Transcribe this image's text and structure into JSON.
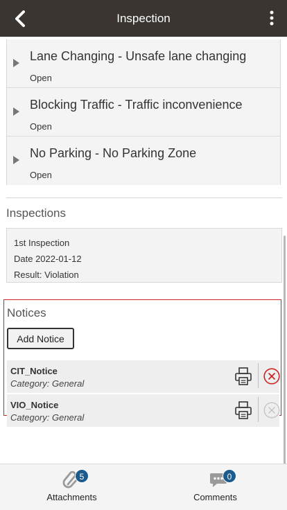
{
  "header": {
    "title": "Inspection",
    "back_icon": "chevron-left-icon",
    "menu_icon": "more-vertical-icon"
  },
  "violations": [
    {
      "title": "Lane Changing - Unsafe lane changing",
      "status": "Open"
    },
    {
      "title": "Blocking Traffic - Traffic inconvenience",
      "status": "Open"
    },
    {
      "title": "No Parking - No Parking Zone",
      "status": "Open"
    }
  ],
  "inspections": {
    "title": "Inspections",
    "card": {
      "name": "1st Inspection",
      "date": "Date 2022-01-12",
      "result": "Result: Violation"
    }
  },
  "notices": {
    "title": "Notices",
    "add_label": "Add Notice",
    "items": [
      {
        "name": "CIT_Notice",
        "category": "Category: General",
        "delete_enabled": true
      },
      {
        "name": "VIO_Notice",
        "category": "Category: General",
        "delete_enabled": false
      }
    ]
  },
  "bottom_tabs": [
    {
      "label": "Attachments",
      "badge": "5",
      "icon": "paperclip-icon"
    },
    {
      "label": "Comments",
      "badge": "0",
      "icon": "comment-icon"
    }
  ],
  "colors": {
    "header_bg": "#3a3530",
    "notices_border": "#cc2222",
    "delete_active": "#cc2222",
    "badge_bg": "#1d5b8c"
  }
}
